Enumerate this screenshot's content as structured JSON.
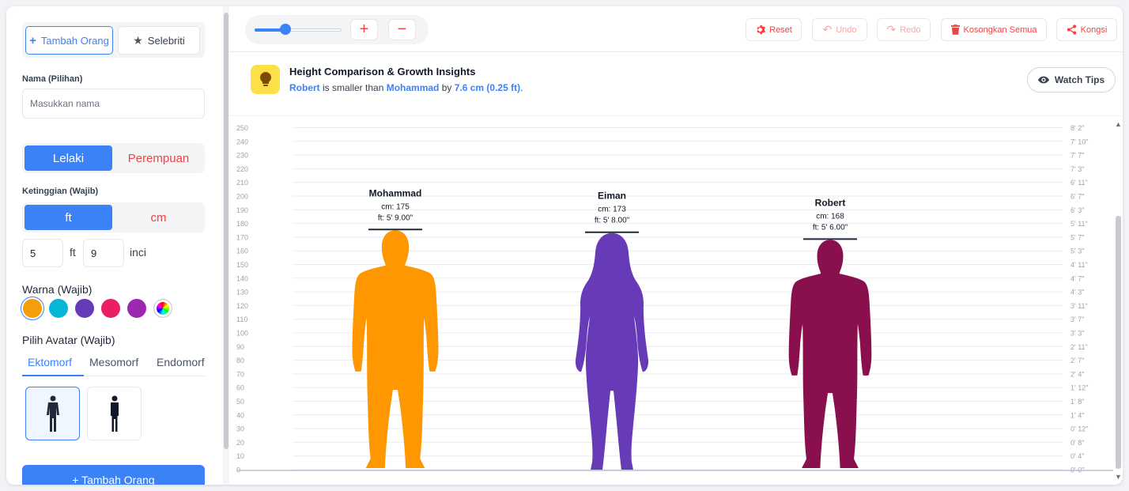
{
  "sidebar": {
    "tab_add": "Tambah Orang",
    "tab_celebrity": "Selebriti",
    "name_label": "Nama (Pilihan)",
    "name_placeholder": "Masukkan nama",
    "gender_male": "Lelaki",
    "gender_female": "Perempuan",
    "height_label": "Ketinggian (Wajib)",
    "unit_ft": "ft",
    "unit_cm": "cm",
    "feet_value": "5",
    "feet_unit": "ft",
    "inch_value": "9",
    "inch_unit": "inci",
    "color_label": "Warna (Wajib)",
    "colors": [
      "#f59e0b",
      "#06b6d4",
      "#673ab7",
      "#e91e63",
      "#9c27b0"
    ],
    "avatar_label": "Pilih Avatar (Wajib)",
    "avatar_tabs": [
      "Ektomorf",
      "Mesomorf",
      "Endomorf"
    ],
    "add_button": "+ Tambah Orang"
  },
  "toolbar": {
    "zoom_level": 0.35,
    "reset": "Reset",
    "undo": "Undo",
    "redo": "Redo",
    "clear_all": "Kosongkan Semua",
    "share": "Kongsi"
  },
  "insight": {
    "title": "Height Comparison & Growth Insights",
    "person_a": "Robert",
    "middle": " is smaller than ",
    "person_b": "Mohammad",
    "by": " by ",
    "difference": "7.6 cm (0.25 ft)",
    "period": ".",
    "watch_tips": "Watch Tips"
  },
  "chart": {
    "cm_ticks": [
      "250",
      "240",
      "230",
      "220",
      "210",
      "200",
      "190",
      "180",
      "170",
      "160",
      "150",
      "140",
      "130",
      "120",
      "110",
      "100",
      "90",
      "80",
      "70",
      "60",
      "50",
      "40",
      "30",
      "20",
      "10",
      "0"
    ],
    "ft_ticks": [
      "8' 2\"",
      "7' 10\"",
      "7' 7\"",
      "7' 3\"",
      "6' 11\"",
      "6' 7\"",
      "6' 3\"",
      "5' 11\"",
      "5' 7\"",
      "5' 3\"",
      "4' 11\"",
      "4' 7\"",
      "4' 3\"",
      "3' 11\"",
      "3' 7\"",
      "3' 3\"",
      "2' 11\"",
      "2' 7\"",
      "2' 4\"",
      "1' 12\"",
      "1' 8\"",
      "1' 4\"",
      "0' 12\"",
      "0' 8\"",
      "0' 4\"",
      "0' 0\""
    ],
    "people": [
      {
        "name": "Mohammad",
        "cm": "cm: 175",
        "ft": "ft: 5' 9.00\"",
        "height": 175,
        "color": "#ff9800",
        "shape": "male"
      },
      {
        "name": "Eiman",
        "cm": "cm: 173",
        "ft": "ft: 5' 8.00\"",
        "height": 173,
        "color": "#673ab7",
        "shape": "female"
      },
      {
        "name": "Robert",
        "cm": "cm: 168",
        "ft": "ft: 5' 6.00\"",
        "height": 168,
        "color": "#8a0f4d",
        "shape": "male"
      }
    ]
  }
}
